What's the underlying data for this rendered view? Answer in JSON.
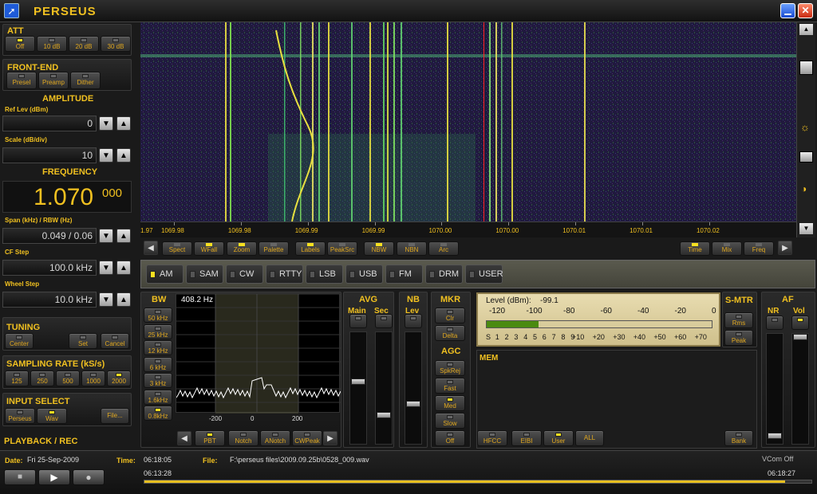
{
  "app": {
    "title": "PERSEUS"
  },
  "att": {
    "title": "ATT",
    "buttons": [
      "Off",
      "10 dB",
      "20 dB",
      "30 dB"
    ]
  },
  "frontend": {
    "title": "FRONT-END",
    "buttons": [
      "Presel",
      "Preamp",
      "Dither"
    ]
  },
  "amplitude": {
    "title": "AMPLITUDE",
    "ref_label": "Ref Lev (dBm)",
    "ref_value": "0",
    "scale_label": "Scale (dB/div)",
    "scale_value": "10"
  },
  "frequency": {
    "title": "FREQUENCY",
    "main": "1.070",
    "sub": "000",
    "span_label": "Span (kHz) / RBW (Hz)",
    "span_value": "0.049 / 0.06",
    "cfstep_label": "CF Step",
    "cfstep_value": "100.0 kHz",
    "wheel_label": "Wheel Step",
    "wheel_value": "10.0 kHz"
  },
  "tuning": {
    "title": "TUNING",
    "buttons": [
      "Center",
      "Set",
      "Cancel"
    ]
  },
  "sampling": {
    "title": "SAMPLING RATE (kS/s)",
    "buttons": [
      "125",
      "250",
      "500",
      "1000",
      "2000"
    ]
  },
  "input": {
    "title": "INPUT SELECT",
    "buttons": [
      "Perseus",
      "Wav",
      "File..."
    ]
  },
  "playback": {
    "title": "PLAYBACK / REC"
  },
  "status": {
    "date_label": "Date:",
    "date_value": "Fri 25-Sep-2009",
    "time_label": "Time:",
    "time_value": "06:18:05",
    "file_label": "File:",
    "file_value": "F:\\perseus files\\2009.09.25b\\0528_009.wav",
    "vcom": "VCom Off",
    "start_time": "06:13:28",
    "end_time": "06:18:27",
    "progress": 0.96
  },
  "waterfall": {
    "ticks": [
      "1069.98",
      "1069.98",
      "1069.99",
      "1069.99",
      "1070.00",
      "1070.00",
      "1070.01",
      "1070.01",
      "1070.02"
    ],
    "ticks_x_kHz": [
      1069.9775,
      1069.9825,
      1069.9875,
      1069.9925,
      1069.9975,
      1070.0025,
      1070.0075,
      1070.0125,
      1070.0175
    ],
    "edge_tick": "1.97"
  },
  "toolbar": {
    "buttons": [
      "Spect",
      "WFall",
      "Zoom",
      "Palette",
      "Labels",
      "PeakSrc",
      "NBW",
      "NBN",
      "Arc"
    ],
    "right": [
      "Time",
      "Mix",
      "Freq"
    ]
  },
  "modes": [
    "AM",
    "SAM",
    "CW",
    "RTTY",
    "LSB",
    "USB",
    "FM",
    "DRM",
    "USER"
  ],
  "bw": {
    "title": "BW",
    "buttons": [
      "50 kHz",
      "25 kHz",
      "12 kHz",
      "6 kHz",
      "3 kHz",
      "1.6kHz",
      "0.8kHz"
    ],
    "readout": "408.2 Hz",
    "ticks": [
      "-200",
      "0",
      "200"
    ],
    "lower_buttons": [
      "PBT",
      "Notch",
      "ANotch",
      "CWPeak"
    ]
  },
  "avg": {
    "title": "AVG",
    "main": "Main",
    "sec": "Sec"
  },
  "nb": {
    "title": "NB",
    "lev": "Lev"
  },
  "mkr": {
    "title": "MKR",
    "buttons": [
      "Clr",
      "Delta"
    ]
  },
  "agc": {
    "title": "AGC",
    "buttons": [
      "SpkRej",
      "Fast",
      "Med",
      "Slow",
      "Off"
    ]
  },
  "level": {
    "label": "Level (dBm):",
    "value": "-99.1",
    "top": [
      "-120",
      "-100",
      "-80",
      "-60",
      "-40",
      "-20",
      "0"
    ],
    "bottom": [
      "S",
      "1",
      "2",
      "3",
      "4",
      "5",
      "6",
      "7",
      "8",
      "9",
      "+10",
      "+20",
      "+30",
      "+40",
      "+50",
      "+60",
      "+70"
    ],
    "fill": 0.23
  },
  "smtr": {
    "title": "S-MTR",
    "buttons": [
      "Rms",
      "Peak"
    ]
  },
  "af": {
    "title": "AF",
    "nr": "NR",
    "vol": "Vol"
  },
  "mem": {
    "title": "MEM",
    "buttons": [
      "HFCC",
      "EIBI",
      "User",
      "ALL"
    ],
    "bank": "Bank"
  }
}
